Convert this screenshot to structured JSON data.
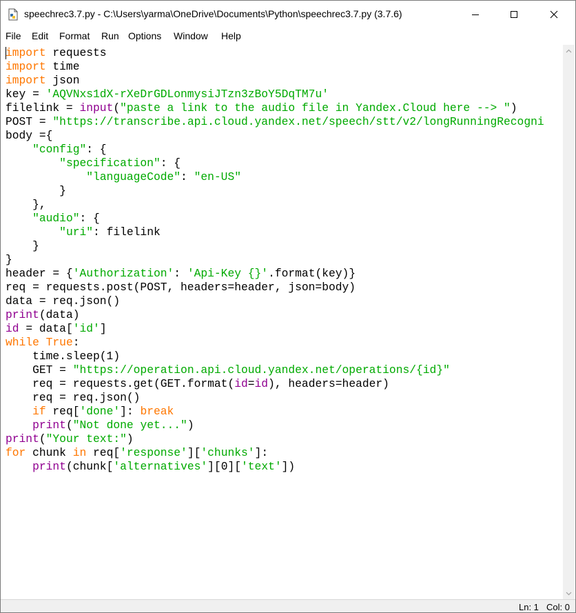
{
  "window": {
    "title": "speechrec3.7.py - C:\\Users\\yarma\\OneDrive\\Documents\\Python\\speechrec3.7.py (3.7.6)",
    "controls": {
      "minimize": "minimize-icon",
      "maximize": "maximize-icon",
      "close": "close-icon"
    }
  },
  "menu": [
    "File",
    "Edit",
    "Format",
    "Run",
    "Options",
    "Window",
    "Help"
  ],
  "status": {
    "line": "Ln: 1",
    "col": "Col: 0"
  },
  "colors": {
    "keyword": "#ff7700",
    "builtin": "#900090",
    "string": "#00aa00",
    "text": "#000000"
  },
  "code": [
    [
      [
        "kw",
        "import"
      ],
      [
        "t",
        " requests"
      ]
    ],
    [
      [
        "kw",
        "import"
      ],
      [
        "t",
        " time"
      ]
    ],
    [
      [
        "kw",
        "import"
      ],
      [
        "t",
        " json"
      ]
    ],
    [
      [
        "t",
        "key = "
      ],
      [
        "st",
        "'AQVNxs1dX-rXeDrGDLonmysiJTzn3zBoY5DqTM7u'"
      ]
    ],
    [
      [
        "t",
        "filelink = "
      ],
      [
        "bi",
        "input"
      ],
      [
        "t",
        "("
      ],
      [
        "st",
        "\"paste a link to the audio file in Yandex.Cloud here --> \""
      ],
      [
        "t",
        ")"
      ]
    ],
    [
      [
        "t",
        "POST = "
      ],
      [
        "st",
        "\"https://transcribe.api.cloud.yandex.net/speech/stt/v2/longRunningRecogni"
      ]
    ],
    [
      [
        "t",
        "body ={"
      ]
    ],
    [
      [
        "t",
        "    "
      ],
      [
        "st",
        "\"config\""
      ],
      [
        "t",
        ": {"
      ]
    ],
    [
      [
        "t",
        "        "
      ],
      [
        "st",
        "\"specification\""
      ],
      [
        "t",
        ": {"
      ]
    ],
    [
      [
        "t",
        "            "
      ],
      [
        "st",
        "\"languageCode\""
      ],
      [
        "t",
        ": "
      ],
      [
        "st",
        "\"en-US\""
      ]
    ],
    [
      [
        "t",
        "        }"
      ]
    ],
    [
      [
        "t",
        "    },"
      ]
    ],
    [
      [
        "t",
        "    "
      ],
      [
        "st",
        "\"audio\""
      ],
      [
        "t",
        ": {"
      ]
    ],
    [
      [
        "t",
        "        "
      ],
      [
        "st",
        "\"uri\""
      ],
      [
        "t",
        ": filelink"
      ]
    ],
    [
      [
        "t",
        "    }"
      ]
    ],
    [
      [
        "t",
        "}"
      ]
    ],
    [
      [
        "t",
        "header = {"
      ],
      [
        "st",
        "'Authorization'"
      ],
      [
        "t",
        ": "
      ],
      [
        "st",
        "'Api-Key {}'"
      ],
      [
        "t",
        ".format(key)}"
      ]
    ],
    [
      [
        "t",
        "req = requests.post(POST, headers=header, json=body)"
      ]
    ],
    [
      [
        "t",
        "data = req.json()"
      ]
    ],
    [
      [
        "bi",
        "print"
      ],
      [
        "t",
        "(data)"
      ]
    ],
    [
      [
        "bi",
        "id"
      ],
      [
        "t",
        " = data["
      ],
      [
        "st",
        "'id'"
      ],
      [
        "t",
        "]"
      ]
    ],
    [
      [
        "kw",
        "while"
      ],
      [
        "t",
        " "
      ],
      [
        "kw",
        "True"
      ],
      [
        "t",
        ":"
      ]
    ],
    [
      [
        "t",
        "    time.sleep(1)"
      ]
    ],
    [
      [
        "t",
        "    GET = "
      ],
      [
        "st",
        "\"https://operation.api.cloud.yandex.net/operations/{id}\""
      ]
    ],
    [
      [
        "t",
        "    req = requests.get(GET.format("
      ],
      [
        "bi",
        "id"
      ],
      [
        "t",
        "="
      ],
      [
        "bi",
        "id"
      ],
      [
        "t",
        "), headers=header)"
      ]
    ],
    [
      [
        "t",
        "    req = req.json()"
      ]
    ],
    [
      [
        "t",
        "    "
      ],
      [
        "kw",
        "if"
      ],
      [
        "t",
        " req["
      ],
      [
        "st",
        "'done'"
      ],
      [
        "t",
        "]: "
      ],
      [
        "kw",
        "break"
      ]
    ],
    [
      [
        "t",
        "    "
      ],
      [
        "bi",
        "print"
      ],
      [
        "t",
        "("
      ],
      [
        "st",
        "\"Not done yet...\""
      ],
      [
        "t",
        ")"
      ]
    ],
    [
      [
        "bi",
        "print"
      ],
      [
        "t",
        "("
      ],
      [
        "st",
        "\"Your text:\""
      ],
      [
        "t",
        ")"
      ]
    ],
    [
      [
        "kw",
        "for"
      ],
      [
        "t",
        " chunk "
      ],
      [
        "kw",
        "in"
      ],
      [
        "t",
        " req["
      ],
      [
        "st",
        "'response'"
      ],
      [
        "t",
        "]["
      ],
      [
        "st",
        "'chunks'"
      ],
      [
        "t",
        "]:"
      ]
    ],
    [
      [
        "t",
        "    "
      ],
      [
        "bi",
        "print"
      ],
      [
        "t",
        "(chunk["
      ],
      [
        "st",
        "'alternatives'"
      ],
      [
        "t",
        "][0]["
      ],
      [
        "st",
        "'text'"
      ],
      [
        "t",
        "])"
      ]
    ]
  ]
}
